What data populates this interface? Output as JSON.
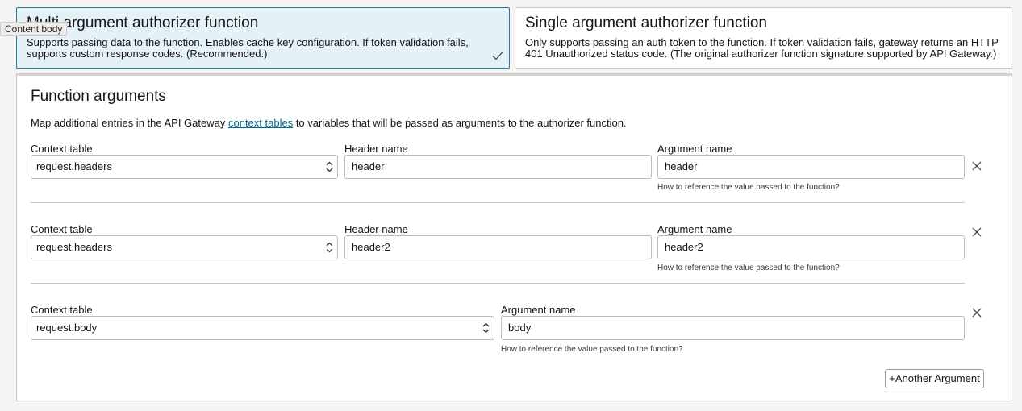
{
  "options": {
    "multi": {
      "title": "Multi argument authorizer function",
      "description": "Supports passing data to the function. Enables cache key configuration. If token validation fails, supports custom response codes. (Recommended.)",
      "selected": true
    },
    "single": {
      "title": "Single argument authorizer function",
      "description": "Only supports passing an auth token to the function. If token validation fails, gateway returns an HTTP 401 Unauthorized status code. (The original authorizer function signature supported by API Gateway.)",
      "selected": false
    }
  },
  "tooltip": "Content body",
  "function_arguments": {
    "title": "Function arguments",
    "desc_before": "Map additional entries in the API Gateway ",
    "desc_link": "context tables",
    "desc_after": " to variables that will be passed as arguments to the authorizer function.",
    "rows": [
      {
        "context_label": "Context table",
        "context_value": "request.headers",
        "header_label": "Header name",
        "header_value": "header",
        "argument_label": "Argument name",
        "argument_value": "header",
        "hint": "How to reference the value passed to the function?"
      },
      {
        "context_label": "Context table",
        "context_value": "request.headers",
        "header_label": "Header name",
        "header_value": "header2",
        "argument_label": "Argument name",
        "argument_value": "header2",
        "hint": "How to reference the value passed to the function?"
      },
      {
        "context_label": "Context table",
        "context_value": "request.body",
        "argument_label": "Argument name",
        "argument_value": "body",
        "hint": "How to reference the value passed to the function?"
      }
    ],
    "add_button": "+Another Argument"
  },
  "colors": {
    "selected_bg": "#e4f1f7",
    "selected_border": "#227e9e",
    "link": "#006b8f"
  }
}
